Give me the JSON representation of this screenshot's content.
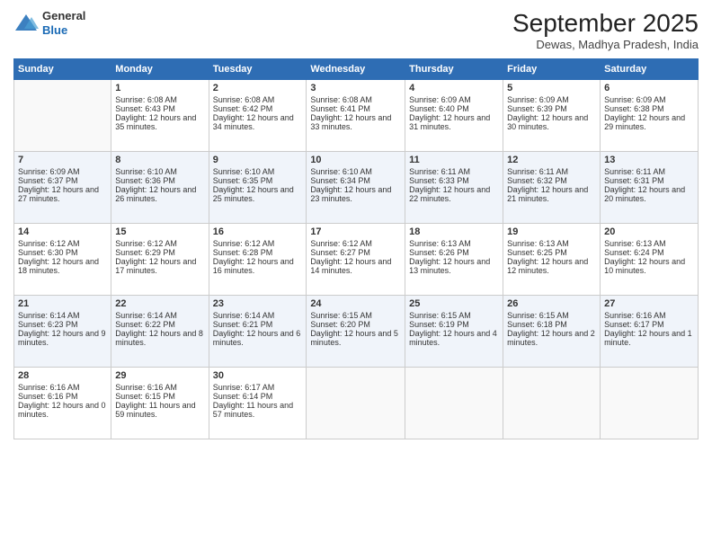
{
  "logo": {
    "general": "General",
    "blue": "Blue"
  },
  "title": "September 2025",
  "subtitle": "Dewas, Madhya Pradesh, India",
  "days": [
    "Sunday",
    "Monday",
    "Tuesday",
    "Wednesday",
    "Thursday",
    "Friday",
    "Saturday"
  ],
  "weeks": [
    [
      {
        "num": "",
        "empty": true
      },
      {
        "num": "1",
        "rise": "6:08 AM",
        "set": "6:43 PM",
        "daylight": "12 hours and 35 minutes."
      },
      {
        "num": "2",
        "rise": "6:08 AM",
        "set": "6:42 PM",
        "daylight": "12 hours and 34 minutes."
      },
      {
        "num": "3",
        "rise": "6:08 AM",
        "set": "6:41 PM",
        "daylight": "12 hours and 33 minutes."
      },
      {
        "num": "4",
        "rise": "6:09 AM",
        "set": "6:40 PM",
        "daylight": "12 hours and 31 minutes."
      },
      {
        "num": "5",
        "rise": "6:09 AM",
        "set": "6:39 PM",
        "daylight": "12 hours and 30 minutes."
      },
      {
        "num": "6",
        "rise": "6:09 AM",
        "set": "6:38 PM",
        "daylight": "12 hours and 29 minutes."
      }
    ],
    [
      {
        "num": "7",
        "rise": "6:09 AM",
        "set": "6:37 PM",
        "daylight": "12 hours and 27 minutes."
      },
      {
        "num": "8",
        "rise": "6:10 AM",
        "set": "6:36 PM",
        "daylight": "12 hours and 26 minutes."
      },
      {
        "num": "9",
        "rise": "6:10 AM",
        "set": "6:35 PM",
        "daylight": "12 hours and 25 minutes."
      },
      {
        "num": "10",
        "rise": "6:10 AM",
        "set": "6:34 PM",
        "daylight": "12 hours and 23 minutes."
      },
      {
        "num": "11",
        "rise": "6:11 AM",
        "set": "6:33 PM",
        "daylight": "12 hours and 22 minutes."
      },
      {
        "num": "12",
        "rise": "6:11 AM",
        "set": "6:32 PM",
        "daylight": "12 hours and 21 minutes."
      },
      {
        "num": "13",
        "rise": "6:11 AM",
        "set": "6:31 PM",
        "daylight": "12 hours and 20 minutes."
      }
    ],
    [
      {
        "num": "14",
        "rise": "6:12 AM",
        "set": "6:30 PM",
        "daylight": "12 hours and 18 minutes."
      },
      {
        "num": "15",
        "rise": "6:12 AM",
        "set": "6:29 PM",
        "daylight": "12 hours and 17 minutes."
      },
      {
        "num": "16",
        "rise": "6:12 AM",
        "set": "6:28 PM",
        "daylight": "12 hours and 16 minutes."
      },
      {
        "num": "17",
        "rise": "6:12 AM",
        "set": "6:27 PM",
        "daylight": "12 hours and 14 minutes."
      },
      {
        "num": "18",
        "rise": "6:13 AM",
        "set": "6:26 PM",
        "daylight": "12 hours and 13 minutes."
      },
      {
        "num": "19",
        "rise": "6:13 AM",
        "set": "6:25 PM",
        "daylight": "12 hours and 12 minutes."
      },
      {
        "num": "20",
        "rise": "6:13 AM",
        "set": "6:24 PM",
        "daylight": "12 hours and 10 minutes."
      }
    ],
    [
      {
        "num": "21",
        "rise": "6:14 AM",
        "set": "6:23 PM",
        "daylight": "12 hours and 9 minutes."
      },
      {
        "num": "22",
        "rise": "6:14 AM",
        "set": "6:22 PM",
        "daylight": "12 hours and 8 minutes."
      },
      {
        "num": "23",
        "rise": "6:14 AM",
        "set": "6:21 PM",
        "daylight": "12 hours and 6 minutes."
      },
      {
        "num": "24",
        "rise": "6:15 AM",
        "set": "6:20 PM",
        "daylight": "12 hours and 5 minutes."
      },
      {
        "num": "25",
        "rise": "6:15 AM",
        "set": "6:19 PM",
        "daylight": "12 hours and 4 minutes."
      },
      {
        "num": "26",
        "rise": "6:15 AM",
        "set": "6:18 PM",
        "daylight": "12 hours and 2 minutes."
      },
      {
        "num": "27",
        "rise": "6:16 AM",
        "set": "6:17 PM",
        "daylight": "12 hours and 1 minute."
      }
    ],
    [
      {
        "num": "28",
        "rise": "6:16 AM",
        "set": "6:16 PM",
        "daylight": "12 hours and 0 minutes."
      },
      {
        "num": "29",
        "rise": "6:16 AM",
        "set": "6:15 PM",
        "daylight": "11 hours and 59 minutes."
      },
      {
        "num": "30",
        "rise": "6:17 AM",
        "set": "6:14 PM",
        "daylight": "11 hours and 57 minutes."
      },
      {
        "num": "",
        "empty": true
      },
      {
        "num": "",
        "empty": true
      },
      {
        "num": "",
        "empty": true
      },
      {
        "num": "",
        "empty": true
      }
    ]
  ]
}
